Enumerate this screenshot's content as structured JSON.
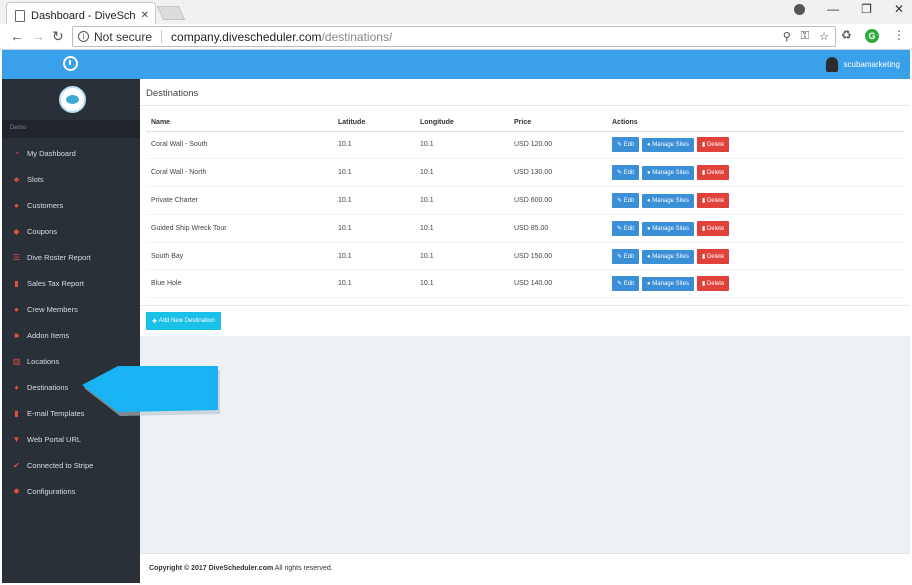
{
  "browser": {
    "tab_title": "Dashboard - DiveSchedu",
    "security": "Not secure",
    "url_host": "company.divescheduler.com",
    "url_path": "/destinations/"
  },
  "header": {
    "username": "scubamarketing"
  },
  "sidebar": {
    "brand": "Demo",
    "items": [
      {
        "label": "My Dashboard",
        "icon": "dashboard-icon"
      },
      {
        "label": "Slots",
        "icon": "sitemap-icon"
      },
      {
        "label": "Customers",
        "icon": "users-icon"
      },
      {
        "label": "Coupons",
        "icon": "tags-icon"
      },
      {
        "label": "Dive Roster Report",
        "icon": "list-icon"
      },
      {
        "label": "Sales Tax Report",
        "icon": "file-icon"
      },
      {
        "label": "Crew Members",
        "icon": "users-icon"
      },
      {
        "label": "Addon Items",
        "icon": "briefcase-icon"
      },
      {
        "label": "Locations",
        "icon": "map-icon"
      },
      {
        "label": "Destinations",
        "icon": "map-marker-icon"
      },
      {
        "label": "E-mail Templates",
        "icon": "file-icon"
      },
      {
        "label": "Web Portal URL",
        "icon": "bookmark-icon"
      },
      {
        "label": "Connected to Stripe",
        "icon": "check-icon"
      },
      {
        "label": "Configurations",
        "icon": "gear-icon"
      }
    ]
  },
  "main": {
    "title": "Destinations",
    "columns": [
      "Name",
      "Latitude",
      "Longitude",
      "Price",
      "Actions"
    ],
    "rows": [
      {
        "name": "Coral Wall - South",
        "lat": "10.1",
        "lng": "10.1",
        "price": "USD 120.00"
      },
      {
        "name": "Coral Wall - North",
        "lat": "10.1",
        "lng": "10.1",
        "price": "USD 130.00"
      },
      {
        "name": "Private Charter",
        "lat": "10.1",
        "lng": "10.1",
        "price": "USD 600.00"
      },
      {
        "name": "Guided Ship Wreck Tour",
        "lat": "10.1",
        "lng": "10.1",
        "price": "USD 85.00"
      },
      {
        "name": "South Bay",
        "lat": "10.1",
        "lng": "10.1",
        "price": "USD 150.00"
      },
      {
        "name": "Blue Hole",
        "lat": "10.1",
        "lng": "10.1",
        "price": "USD 140.00"
      }
    ],
    "actions": {
      "edit": "Edit",
      "sites": "Manage Sites",
      "delete": "Delete"
    },
    "add_button": "Add New Destination"
  },
  "footer": {
    "prefix": "Copyright © 2017 DiveScheduler.com",
    "suffix": "All rights reserved."
  },
  "colors": {
    "header": "#3aa0ea",
    "sidebar": "#293038",
    "primary_btn": "#3a8fd6",
    "danger_btn": "#e0423a",
    "add_btn": "#1bc0e8",
    "callout": "#19b2f2"
  }
}
